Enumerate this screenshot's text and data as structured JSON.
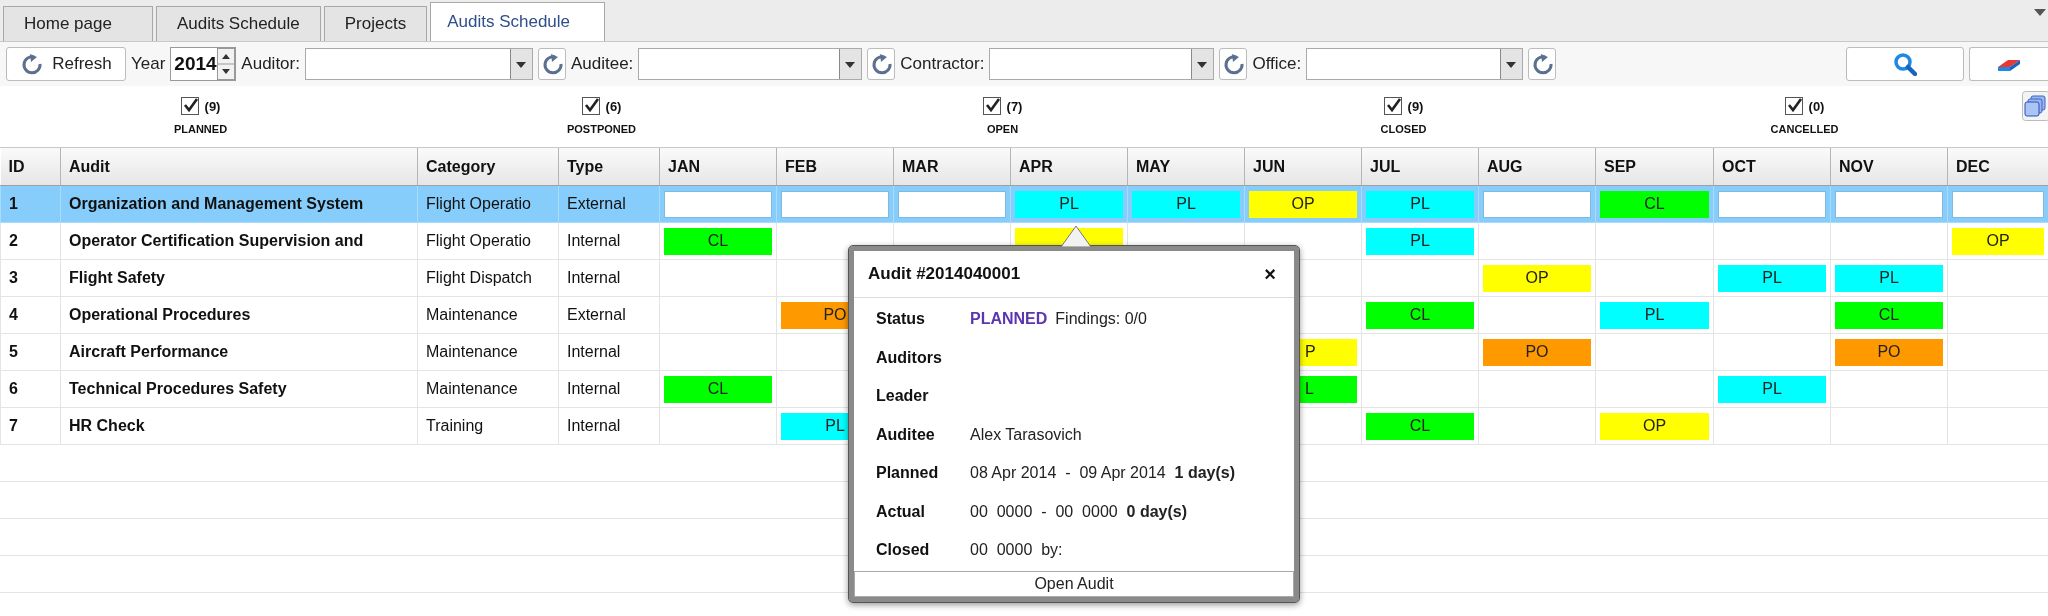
{
  "tabs": [
    {
      "label": "Home page",
      "selected": false
    },
    {
      "label": "Audits Schedule",
      "selected": false
    },
    {
      "label": "Projects",
      "selected": false
    },
    {
      "label": "Audits Schedule",
      "selected": true
    }
  ],
  "toolbar": {
    "refresh": "Refresh",
    "year_label": "Year",
    "year": "2014",
    "filters": [
      {
        "label": "Auditor:"
      },
      {
        "label": "Auditee:"
      },
      {
        "label": "Contractor:"
      },
      {
        "label": "Office:"
      }
    ]
  },
  "status_filters": [
    {
      "count": "(9)",
      "label": "PLANNED",
      "checked": true
    },
    {
      "count": "(6)",
      "label": "POSTPONED",
      "checked": true
    },
    {
      "count": "(7)",
      "label": "OPEN",
      "checked": true
    },
    {
      "count": "(9)",
      "label": "CLOSED",
      "checked": true
    },
    {
      "count": "(0)",
      "label": "CANCELLED",
      "checked": true
    }
  ],
  "table": {
    "columns": [
      "ID",
      "Audit",
      "Category",
      "Type",
      "JAN",
      "FEB",
      "MAR",
      "APR",
      "MAY",
      "JUN",
      "JUL",
      "AUG",
      "SEP",
      "OCT",
      "NOV",
      "DEC"
    ],
    "rows": [
      {
        "id": "1",
        "audit": "Organization and Management System",
        "category": "Flight Operatio",
        "type": "External",
        "selected": true,
        "months": [
          {
            "kind": "blank"
          },
          {
            "kind": "blank"
          },
          {
            "kind": "blank"
          },
          {
            "kind": "status",
            "text": "PL",
            "color": "#00ffff"
          },
          {
            "kind": "status",
            "text": "PL",
            "color": "#00ffff"
          },
          {
            "kind": "status",
            "text": "OP",
            "color": "#ffff00"
          },
          {
            "kind": "status",
            "text": "PL",
            "color": "#00ffff"
          },
          {
            "kind": "blank"
          },
          {
            "kind": "status",
            "text": "CL",
            "color": "#00ff00"
          },
          {
            "kind": "blank"
          },
          {
            "kind": "blank"
          },
          {
            "kind": "blank"
          }
        ]
      },
      {
        "id": "2",
        "audit": "Operator Certification Supervision and",
        "category": "Flight Operatio",
        "type": "Internal",
        "selected": false,
        "months": [
          {
            "kind": "status",
            "text": "CL",
            "color": "#00ff00"
          },
          {
            "kind": "empty"
          },
          {
            "kind": "empty"
          },
          {
            "kind": "covered",
            "color": "#ffff00"
          },
          {
            "kind": "empty"
          },
          {
            "kind": "empty"
          },
          {
            "kind": "status",
            "text": "PL",
            "color": "#00ffff"
          },
          {
            "kind": "empty"
          },
          {
            "kind": "empty"
          },
          {
            "kind": "empty"
          },
          {
            "kind": "empty"
          },
          {
            "kind": "status",
            "text": "OP",
            "color": "#ffff00"
          }
        ]
      },
      {
        "id": "3",
        "audit": "Flight Safety",
        "category": "Flight Dispatch",
        "type": "Internal",
        "selected": false,
        "months": [
          {
            "kind": "empty"
          },
          {
            "kind": "empty"
          },
          {
            "kind": "empty"
          },
          {
            "kind": "empty"
          },
          {
            "kind": "empty"
          },
          {
            "kind": "empty"
          },
          {
            "kind": "empty"
          },
          {
            "kind": "status",
            "text": "OP",
            "color": "#ffff00"
          },
          {
            "kind": "empty"
          },
          {
            "kind": "status",
            "text": "PL",
            "color": "#00ffff"
          },
          {
            "kind": "status",
            "text": "PL",
            "color": "#00ffff"
          },
          {
            "kind": "empty"
          }
        ]
      },
      {
        "id": "4",
        "audit": "Operational Procedures",
        "category": "Maintenance",
        "type": "External",
        "selected": false,
        "months": [
          {
            "kind": "empty"
          },
          {
            "kind": "status",
            "text": "PO",
            "color": "#ff9900"
          },
          {
            "kind": "empty"
          },
          {
            "kind": "empty"
          },
          {
            "kind": "empty"
          },
          {
            "kind": "empty"
          },
          {
            "kind": "status",
            "text": "CL",
            "color": "#00ff00"
          },
          {
            "kind": "empty"
          },
          {
            "kind": "status",
            "text": "PL",
            "color": "#00ffff"
          },
          {
            "kind": "empty"
          },
          {
            "kind": "status",
            "text": "CL",
            "color": "#00ff00"
          },
          {
            "kind": "empty"
          }
        ]
      },
      {
        "id": "5",
        "audit": "Aircraft Performance",
        "category": "Maintenance",
        "type": "Internal",
        "selected": false,
        "months": [
          {
            "kind": "empty"
          },
          {
            "kind": "empty"
          },
          {
            "kind": "empty"
          },
          {
            "kind": "empty"
          },
          {
            "kind": "empty"
          },
          {
            "kind": "covered",
            "text": "P",
            "color": "#ffff00"
          },
          {
            "kind": "empty"
          },
          {
            "kind": "status",
            "text": "PO",
            "color": "#ff9900"
          },
          {
            "kind": "empty"
          },
          {
            "kind": "empty"
          },
          {
            "kind": "status",
            "text": "PO",
            "color": "#ff9900"
          },
          {
            "kind": "empty"
          }
        ]
      },
      {
        "id": "6",
        "audit": "Technical Procedures Safety",
        "category": "Maintenance",
        "type": "Internal",
        "selected": false,
        "months": [
          {
            "kind": "status",
            "text": "CL",
            "color": "#00ff00"
          },
          {
            "kind": "empty"
          },
          {
            "kind": "empty"
          },
          {
            "kind": "empty"
          },
          {
            "kind": "empty"
          },
          {
            "kind": "covered",
            "text": "L",
            "color": "#00ff00"
          },
          {
            "kind": "empty"
          },
          {
            "kind": "empty"
          },
          {
            "kind": "empty"
          },
          {
            "kind": "status",
            "text": "PL",
            "color": "#00ffff"
          },
          {
            "kind": "empty"
          },
          {
            "kind": "empty"
          }
        ]
      },
      {
        "id": "7",
        "audit": "HR Check",
        "category": "Training",
        "type": "Internal",
        "selected": false,
        "months": [
          {
            "kind": "empty"
          },
          {
            "kind": "status",
            "text": "PL",
            "color": "#00ffff"
          },
          {
            "kind": "empty"
          },
          {
            "kind": "empty"
          },
          {
            "kind": "empty"
          },
          {
            "kind": "empty"
          },
          {
            "kind": "status",
            "text": "CL",
            "color": "#00ff00"
          },
          {
            "kind": "empty"
          },
          {
            "kind": "status",
            "text": "OP",
            "color": "#ffff00"
          },
          {
            "kind": "empty"
          },
          {
            "kind": "empty"
          },
          {
            "kind": "empty"
          }
        ]
      }
    ]
  },
  "popup": {
    "title": "Audit #2014040001",
    "close": "×",
    "fields": [
      {
        "kind": "status",
        "label": "Status",
        "status": "PLANNED",
        "value": "Findings: 0/0"
      },
      {
        "kind": "text",
        "label": "Auditors"
      },
      {
        "kind": "text",
        "label": "Leader"
      },
      {
        "kind": "text",
        "label": "Auditee",
        "value": "Alex Tarasovich"
      },
      {
        "kind": "text",
        "label": "Planned",
        "value": "08 Apr 2014  -  09 Apr 2014  **1 day(s)**"
      },
      {
        "kind": "text",
        "label": "Actual",
        "value": "00  0000  -  00  0000  **0 day(s)**"
      },
      {
        "kind": "text",
        "label": "Closed",
        "value": "00  0000  by:"
      }
    ],
    "button": "Open Audit"
  }
}
